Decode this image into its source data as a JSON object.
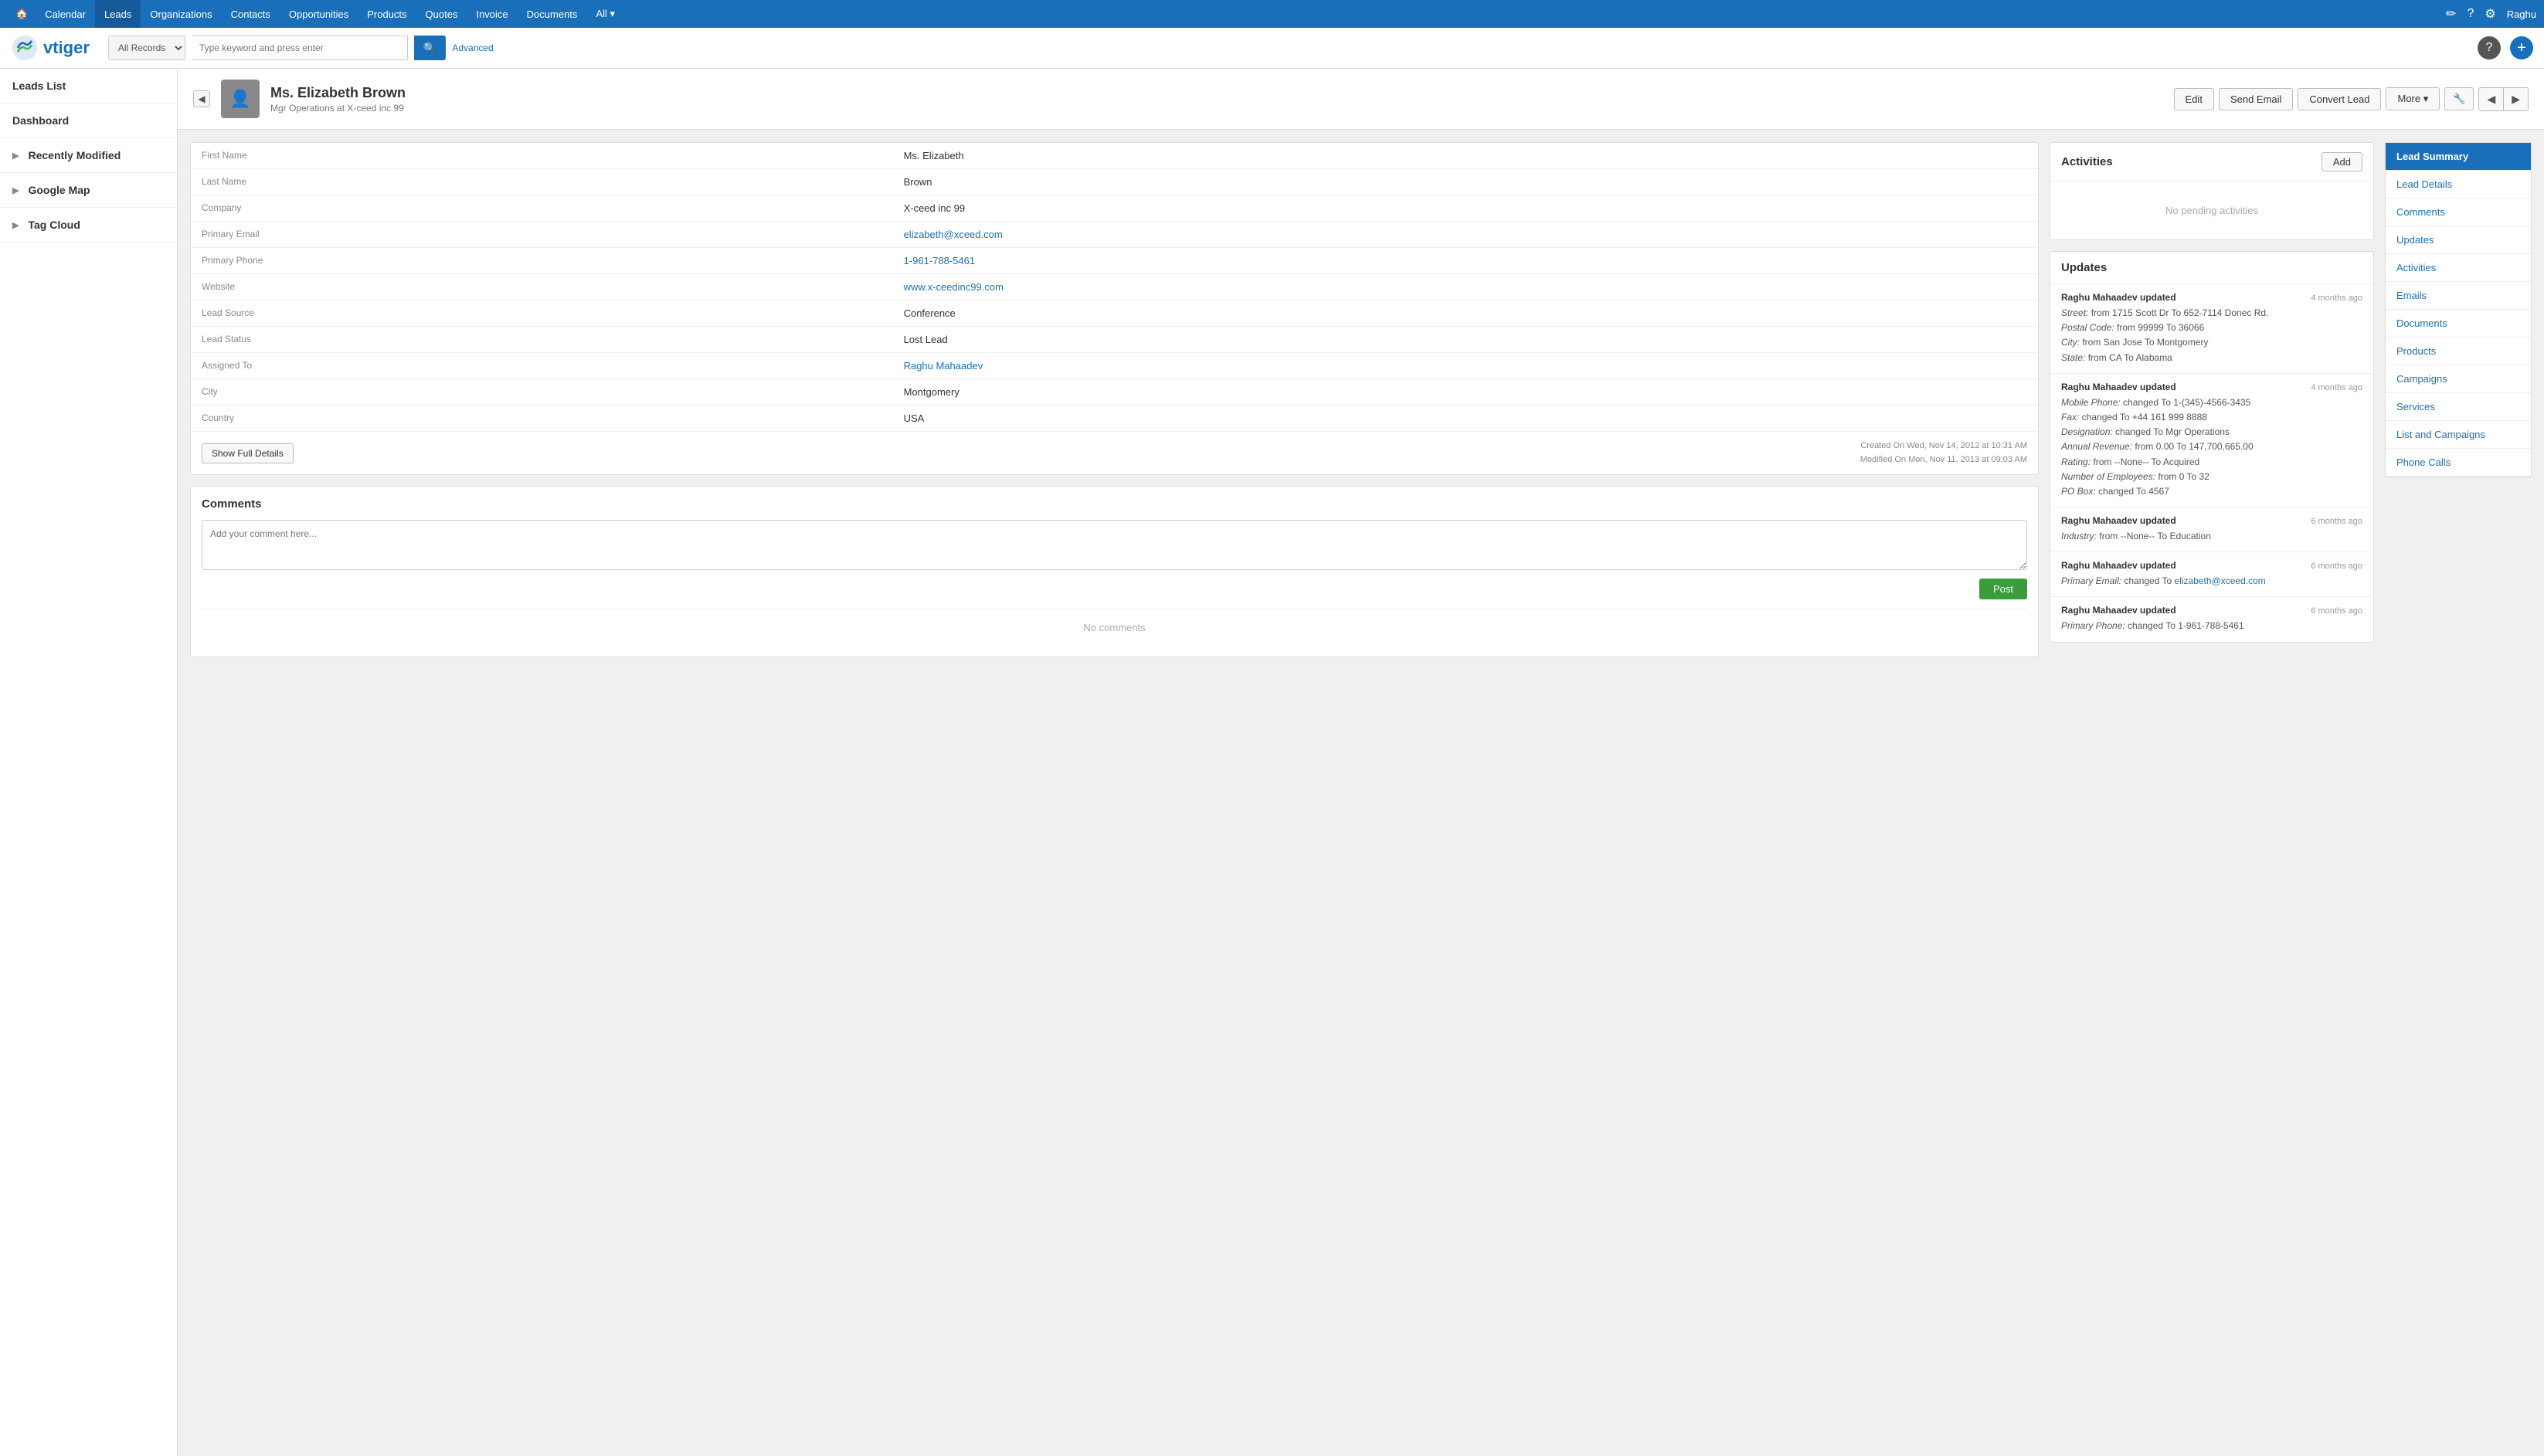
{
  "topnav": {
    "items": [
      {
        "label": "🏠",
        "id": "home",
        "active": false
      },
      {
        "label": "Calendar",
        "id": "calendar",
        "active": false
      },
      {
        "label": "Leads",
        "id": "leads",
        "active": true
      },
      {
        "label": "Organizations",
        "id": "organizations",
        "active": false
      },
      {
        "label": "Contacts",
        "id": "contacts",
        "active": false
      },
      {
        "label": "Opportunities",
        "id": "opportunities",
        "active": false
      },
      {
        "label": "Products",
        "id": "products",
        "active": false
      },
      {
        "label": "Quotes",
        "id": "quotes",
        "active": false
      },
      {
        "label": "Invoice",
        "id": "invoice",
        "active": false
      },
      {
        "label": "Documents",
        "id": "documents",
        "active": false
      },
      {
        "label": "All ▾",
        "id": "all",
        "active": false
      }
    ],
    "icons": {
      "pencil": "✏",
      "help": "?",
      "settings": "⚙",
      "user": "Raghu"
    }
  },
  "searchbar": {
    "select_value": "All Records",
    "input_placeholder": "Type keyword and press enter",
    "advanced_label": "Advanced",
    "search_icon": "🔍"
  },
  "sidebar": {
    "items": [
      {
        "label": "Leads List",
        "has_arrow": false
      },
      {
        "label": "Dashboard",
        "has_arrow": false
      },
      {
        "label": "Recently Modified",
        "has_arrow": true
      },
      {
        "label": "Google Map",
        "has_arrow": true
      },
      {
        "label": "Tag Cloud",
        "has_arrow": true
      }
    ]
  },
  "record": {
    "salutation": "Ms.",
    "full_name": "Ms. Elizabeth Brown",
    "subtitle": "Mgr Operations at X-ceed inc 99",
    "avatar_icon": "👤",
    "actions": {
      "edit": "Edit",
      "send_email": "Send Email",
      "convert_lead": "Convert Lead",
      "more": "More ▾",
      "tools_icon": "🔧",
      "prev": "◀",
      "next": "▶"
    }
  },
  "details": {
    "fields": [
      {
        "label": "First Name",
        "value": "Ms. Elizabeth",
        "type": "text"
      },
      {
        "label": "Last Name",
        "value": "Brown",
        "type": "text"
      },
      {
        "label": "Company",
        "value": "X-ceed inc 99",
        "type": "text"
      },
      {
        "label": "Primary Email",
        "value": "elizabeth@xceed.com",
        "type": "link"
      },
      {
        "label": "Primary Phone",
        "value": "1-961-788-5461",
        "type": "link"
      },
      {
        "label": "Website",
        "value": "www.x-ceedinc99.com",
        "type": "link"
      },
      {
        "label": "Lead Source",
        "value": "Conference",
        "type": "text"
      },
      {
        "label": "Lead Status",
        "value": "Lost Lead",
        "type": "text"
      },
      {
        "label": "Assigned To",
        "value": "Raghu Mahaadev",
        "type": "link"
      },
      {
        "label": "City",
        "value": "Montgomery",
        "type": "text"
      },
      {
        "label": "Country",
        "value": "USA",
        "type": "text"
      }
    ],
    "show_full_details": "Show Full Details",
    "created_on": "Created On Wed, Nov 14, 2012 at 10:31 AM",
    "modified_on": "Modified On Mon, Nov 11, 2013 at 09:03 AM"
  },
  "comments": {
    "title": "Comments",
    "placeholder": "Add your comment here...",
    "post_btn": "Post",
    "no_comments_text": "No comments"
  },
  "activities": {
    "title": "Activities",
    "add_btn": "Add",
    "no_activities": "No pending activities"
  },
  "updates": {
    "title": "Updates",
    "entries": [
      {
        "author": "Raghu Mahaadev",
        "action": "updated",
        "time": "4 months ago",
        "lines": [
          "Street: from 1715 Scott Dr To 652-7114 Donec Rd.",
          "Postal Code: from 99999 To 36066",
          "City: from San Jose To Montgomery",
          "State: from CA To Alabama"
        ]
      },
      {
        "author": "Raghu Mahaadev",
        "action": "updated",
        "time": "4 months ago",
        "lines": [
          "Mobile Phone: changed To 1-(345)-4566-3435",
          "Fax: changed To +44 161 999 8888",
          "Designation: changed To Mgr Operations",
          "Annual Revenue: from 0.00 To 147,700,665.00",
          "Rating: from --None-- To Acquired",
          "Number of Employees: from 0 To 32",
          "PO Box: changed To 4567"
        ]
      },
      {
        "author": "Raghu Mahaadev",
        "action": "updated",
        "time": "6 months ago",
        "lines": [
          "Industry: from --None-- To Education"
        ]
      },
      {
        "author": "Raghu Mahaadev",
        "action": "updated",
        "time": "6 months ago",
        "lines": [
          "Primary Email: changed To elizabeth@xceed.com"
        ],
        "has_link": true,
        "link_text": "elizabeth@xceed.com"
      },
      {
        "author": "Raghu Mahaadev",
        "action": "updated",
        "time": "6 months ago",
        "lines": [
          "Primary Phone: changed To 1-961-788-5461"
        ]
      }
    ]
  },
  "right_nav": {
    "items": [
      {
        "label": "Lead Summary",
        "active": true
      },
      {
        "label": "Lead Details"
      },
      {
        "label": "Comments"
      },
      {
        "label": "Updates"
      },
      {
        "label": "Activities"
      },
      {
        "label": "Emails"
      },
      {
        "label": "Documents"
      },
      {
        "label": "Products"
      },
      {
        "label": "Campaigns"
      },
      {
        "label": "Services"
      },
      {
        "label": "List and Campaigns"
      },
      {
        "label": "Phone Calls"
      }
    ]
  }
}
